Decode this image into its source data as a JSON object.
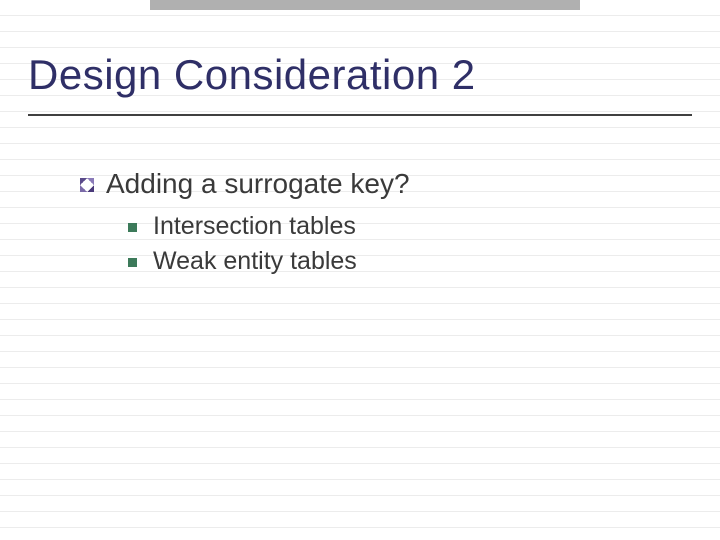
{
  "title": "Design Consideration 2",
  "body": {
    "level1": {
      "text": "Adding a surrogate key?"
    },
    "level2": [
      {
        "text": "Intersection tables"
      },
      {
        "text": "Weak entity tables"
      }
    ]
  }
}
